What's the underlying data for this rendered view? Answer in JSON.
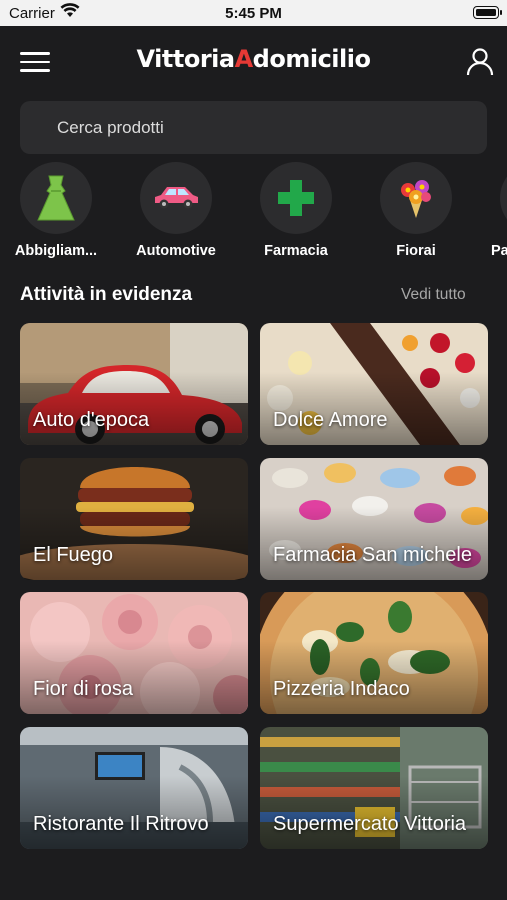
{
  "status_bar": {
    "carrier": "Carrier",
    "time": "5:45 PM"
  },
  "header": {
    "logo_part1": "Vittoria",
    "logo_part2": "A",
    "logo_part3": "domicilio"
  },
  "search": {
    "placeholder": "Cerca prodotti"
  },
  "categories": [
    {
      "label": "Abbigliam...",
      "icon": "dress-icon"
    },
    {
      "label": "Automotive",
      "icon": "car-icon"
    },
    {
      "label": "Farmacia",
      "icon": "pharmacy-cross-icon"
    },
    {
      "label": "Fiorai",
      "icon": "flower-bouquet-icon"
    },
    {
      "label": "Pa",
      "icon": "category-icon"
    }
  ],
  "featured": {
    "title": "Attività in evidenza",
    "see_all": "Vedi tutto",
    "items": [
      {
        "name": "Auto d'epoca"
      },
      {
        "name": "Dolce Amore"
      },
      {
        "name": "El Fuego"
      },
      {
        "name": "Farmacia San michele"
      },
      {
        "name": "Fior di rosa"
      },
      {
        "name": "Pizzeria Indaco"
      },
      {
        "name": "Ristorante Il Ritrovo"
      },
      {
        "name": "Supermercato Vittoria"
      }
    ]
  },
  "colors": {
    "background": "#1c1c1e",
    "surface": "#2c2c2e",
    "accent": "#e53935"
  }
}
